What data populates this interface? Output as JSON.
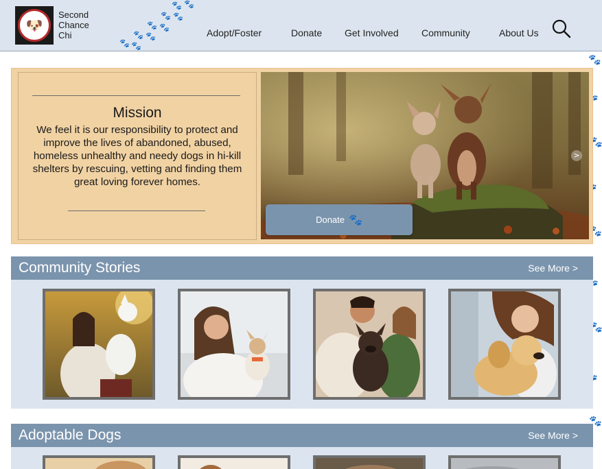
{
  "brand": {
    "name_line1": "Second",
    "name_line2": "Chance",
    "name_line3": "Chi"
  },
  "nav": {
    "adopt_foster": "Adopt/Foster",
    "donate": "Donate",
    "get_involved": "Get Involved",
    "community": "Community",
    "about_us": "About Us"
  },
  "mission": {
    "title": "Mission",
    "body": "We feel it is our responsibility to protect and improve the lives of abandoned, abused, homeless unhealthy and needy dogs in hi-kill shelters by rescuing, vetting and finding them great loving forever homes."
  },
  "hero": {
    "donate_label": "Donate",
    "next_arrow": ">"
  },
  "community_stories": {
    "title": "Community Stories",
    "see_more": "See More >"
  },
  "adoptable_dogs": {
    "title": "Adoptable Dogs",
    "see_more": "See More >"
  },
  "colors": {
    "header_bg": "#dce5ef",
    "section_bar": "#7b94ad",
    "mission_bg": "#f1d2a3",
    "photo_border": "#6e6e6e"
  },
  "icons": {
    "search": "search-icon",
    "paw": "paw-icon",
    "next": "chevron-right-icon"
  }
}
